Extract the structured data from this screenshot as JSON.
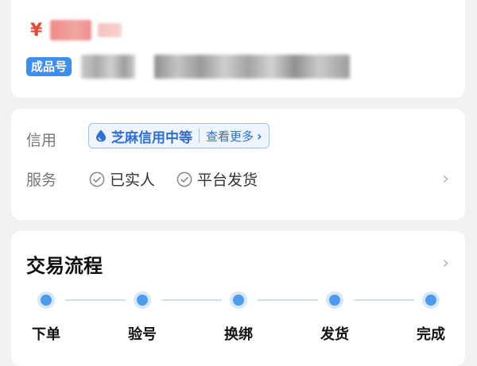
{
  "price": {
    "currency_symbol": "¥"
  },
  "product": {
    "badge_label": "成品号"
  },
  "credit": {
    "label": "信用",
    "tag_name": "芝麻信用中等",
    "more_label": "查看更多",
    "chevron": "›"
  },
  "service": {
    "label": "服务",
    "items": [
      {
        "label": "已实人",
        "icon": "check-circle-icon"
      },
      {
        "label": "平台发货",
        "icon": "check-circle-icon"
      }
    ],
    "chevron": "›"
  },
  "process": {
    "title": "交易流程",
    "chevron": "›",
    "steps": [
      {
        "label": "下单"
      },
      {
        "label": "验号"
      },
      {
        "label": "换绑"
      },
      {
        "label": "发货"
      },
      {
        "label": "完成"
      }
    ]
  },
  "colors": {
    "accent": "#3d8ef0",
    "price_red": "#e8462e",
    "credit_blue": "#2c6fd6",
    "step_dot": "#4c9bef",
    "background": "#f1f2f4"
  }
}
